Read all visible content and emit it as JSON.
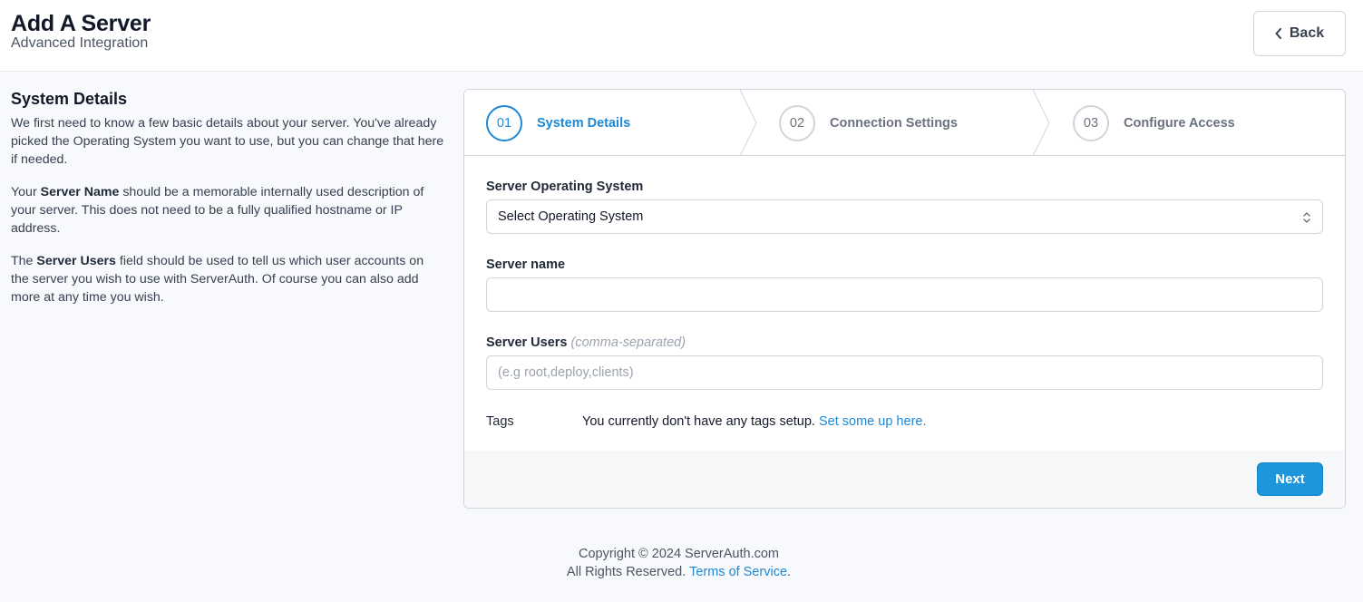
{
  "header": {
    "title": "Add A Server",
    "subtitle": "Advanced Integration",
    "back_label": "Back"
  },
  "sidebar": {
    "heading": "System Details",
    "p1": "We first need to know a few basic details about your server. You've already picked the Operating System you want to use, but you can change that here if needed.",
    "p2_pre": "Your ",
    "p2_bold": "Server Name",
    "p2_post": " should be a memorable internally used description of your server. This does not need to be a fully qualified hostname or IP address.",
    "p3_pre": "The ",
    "p3_bold": "Server Users",
    "p3_post": " field should be used to tell us which user accounts on the server you wish to use with ServerAuth. Of course you can also add more at any time you wish."
  },
  "steps": [
    {
      "number": "01",
      "label": "System Details",
      "active": true
    },
    {
      "number": "02",
      "label": "Connection Settings",
      "active": false
    },
    {
      "number": "03",
      "label": "Configure Access",
      "active": false
    }
  ],
  "form": {
    "os_label": "Server Operating System",
    "os_value": "Select Operating System",
    "name_label": "Server name",
    "name_value": "",
    "users_label": "Server Users",
    "users_hint": "(comma-separated)",
    "users_placeholder": "(e.g root,deploy,clients)",
    "tags_label": "Tags",
    "tags_text": "You currently don't have any tags setup.",
    "tags_link": "Set some up here.",
    "next_label": "Next"
  },
  "footer": {
    "copyright": "Copyright © 2024 ServerAuth.com",
    "rights": "All Rights Reserved.",
    "terms_link": "Terms of Service",
    "terms_suffix": "."
  },
  "colors": {
    "accent": "#1e88d6",
    "button": "#1e96dc"
  }
}
